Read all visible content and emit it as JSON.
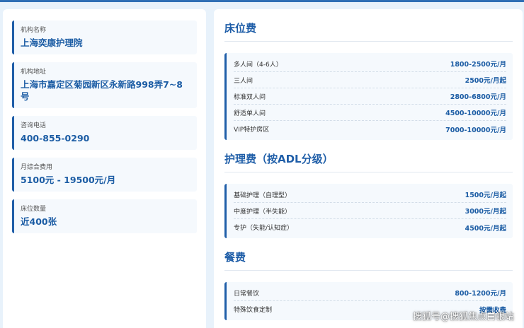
{
  "left": {
    "cards": [
      {
        "label": "机构名称",
        "value": "上海奕康护理院"
      },
      {
        "label": "机构地址",
        "value": "上海市嘉定区菊园新区永新路998弄7~8号"
      },
      {
        "label": "咨询电话",
        "value": "400-855-0290"
      },
      {
        "label": "月综合费用",
        "value": "5100元 - 19500元/月"
      },
      {
        "label": "床位数量",
        "value": "近400张"
      }
    ]
  },
  "right": {
    "bed": {
      "title": "床位费",
      "rows": [
        {
          "name": "多人间（4-6人）",
          "price": "1800-2500元/月"
        },
        {
          "name": "三人间",
          "price": "2500元/月起"
        },
        {
          "name": "标准双人间",
          "price": "2800-6800元/月"
        },
        {
          "name": "舒适单人间",
          "price": "4500-10000元/月"
        },
        {
          "name": "VIP特护房区",
          "price": "7000-10000元/月"
        }
      ]
    },
    "care": {
      "title": "护理费（按ADL分级）",
      "rows": [
        {
          "name": "基础护理（自理型）",
          "price": "1500元/月起"
        },
        {
          "name": "中度护理（半失能）",
          "price": "3000元/月起"
        },
        {
          "name": "专护（失能/认知症）",
          "price": "4500元/月起"
        }
      ]
    },
    "meal": {
      "title": "餐费",
      "rows": [
        {
          "name": "日常餐饮",
          "price": "800-1200元/月"
        },
        {
          "name": "特殊饮食定制",
          "price": "按需收费"
        }
      ]
    }
  },
  "watermark": "搜狐号@搜狐焦点白银站",
  "colors": {
    "accent": "#1f5ea8",
    "value_text": "#1b5ca4",
    "page_bg": "#e8f2fb"
  }
}
